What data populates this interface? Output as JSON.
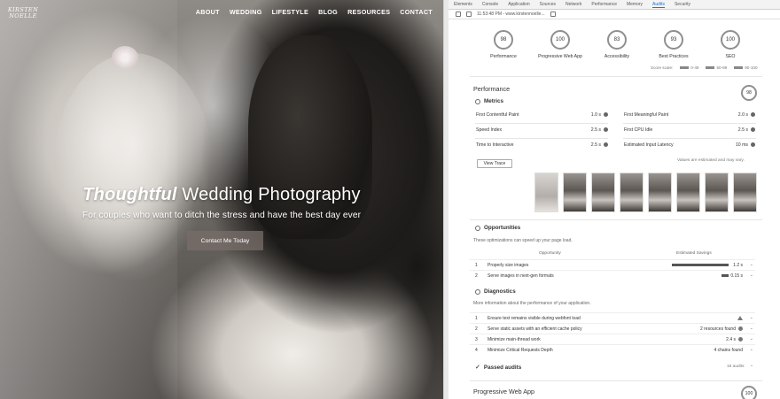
{
  "site": {
    "logo_line1": "KIRSTEN",
    "logo_line2": "NOELLE",
    "nav": [
      "ABOUT",
      "WEDDING",
      "LIFESTYLE",
      "BLOG",
      "RESOURCES",
      "CONTACT"
    ],
    "hero_title_em": "Thoughtful",
    "hero_title_rest": " Wedding Photography",
    "hero_sub": "For couples who want to ditch the stress and have the best day ever",
    "cta": "Contact Me Today"
  },
  "devtools": {
    "tabs": [
      "Elements",
      "Console",
      "Application",
      "Sources",
      "Network",
      "Performance",
      "Memory",
      "Audits",
      "Security"
    ],
    "active_tab": "Audits",
    "toolbar_text": "11:53:48 PM - www.kirstennoelle...",
    "gauges": [
      {
        "score": "98",
        "label": "Performance"
      },
      {
        "score": "100",
        "label": "Progressive Web App"
      },
      {
        "score": "83",
        "label": "Accessibility"
      },
      {
        "score": "93",
        "label": "Best Practices"
      },
      {
        "score": "100",
        "label": "SEO"
      }
    ],
    "legend": {
      "scale": "Score scale:",
      "r1": "0-49",
      "r2": "50-89",
      "r3": "90-100"
    },
    "performance": {
      "title": "Performance",
      "score": "98",
      "metrics_title": "Metrics",
      "metrics": [
        {
          "label": "First Contentful Paint",
          "value": "1.0 s"
        },
        {
          "label": "First Meaningful Paint",
          "value": "2.0 s"
        },
        {
          "label": "Speed Index",
          "value": "2.5 s"
        },
        {
          "label": "First CPU Idle",
          "value": "2.5 s"
        },
        {
          "label": "Time to Interactive",
          "value": "2.5 s"
        },
        {
          "label": "Estimated Input Latency",
          "value": "10 ms"
        }
      ],
      "view_trace": "View Trace",
      "estimate_note": "Values are estimated and may vary."
    },
    "opportunities": {
      "title": "Opportunities",
      "desc": "These optimizations can speed up your page load.",
      "col1": "Opportunity",
      "col2": "Estimated Savings",
      "rows": [
        {
          "n": "1",
          "label": "Properly size images",
          "value": "1.2 s"
        },
        {
          "n": "2",
          "label": "Serve images in next-gen formats",
          "value": "0.15 s"
        }
      ]
    },
    "diagnostics": {
      "title": "Diagnostics",
      "desc": "More information about the performance of your application.",
      "rows": [
        {
          "n": "1",
          "label": "Ensure text remains visible during webfont load",
          "value": ""
        },
        {
          "n": "2",
          "label": "Serve static assets with an efficient cache policy",
          "value": "2 resources found"
        },
        {
          "n": "3",
          "label": "Minimize main-thread work",
          "value": "2.4 s"
        },
        {
          "n": "4",
          "label": "Minimize Critical Requests Depth",
          "value": "4 chains found"
        }
      ]
    },
    "passed": {
      "title": "Passed audits",
      "count": "16 audits"
    },
    "pwa": {
      "title": "Progressive Web App",
      "score": "100"
    }
  }
}
